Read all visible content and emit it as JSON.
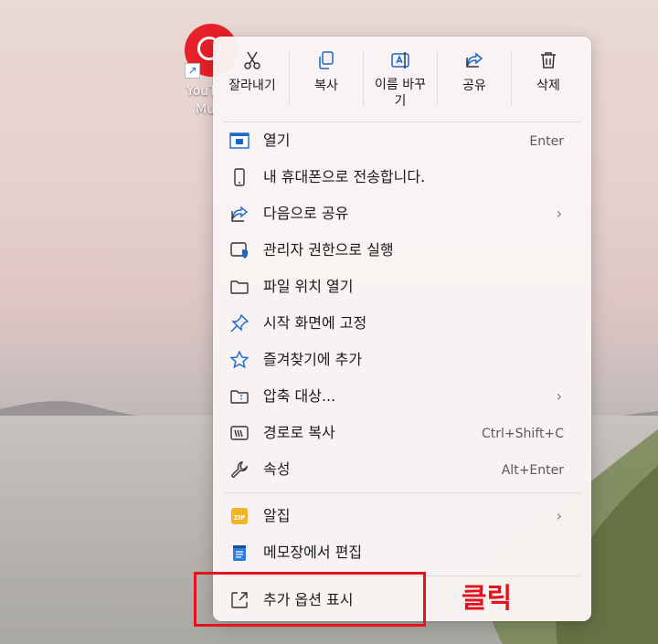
{
  "desktop": {
    "icon_label_line1": "YouTube",
    "icon_label_line2": "Music"
  },
  "toolbar": [
    {
      "label": "잘라내기",
      "icon": "scissors-icon"
    },
    {
      "label": "복사",
      "icon": "copy-icon"
    },
    {
      "label_line1": "이름 바꾸",
      "label_line2": "기",
      "icon": "rename-icon"
    },
    {
      "label": "공유",
      "icon": "share-icon"
    },
    {
      "label": "삭제",
      "icon": "trash-icon"
    }
  ],
  "items": [
    {
      "label": "열기",
      "shortcut": "Enter",
      "icon": "app-window-icon"
    },
    {
      "label": "내 휴대폰으로 전송합니다.",
      "icon": "phone-icon"
    },
    {
      "label": "다음으로 공유",
      "submenu": true,
      "icon": "share-icon"
    },
    {
      "label": "관리자 권한으로 실행",
      "icon": "shield-window-icon"
    },
    {
      "label": "파일 위치 열기",
      "icon": "folder-icon"
    },
    {
      "label": "시작 화면에 고정",
      "icon": "pin-icon"
    },
    {
      "label": "즐겨찾기에 추가",
      "icon": "star-icon"
    },
    {
      "label": "압축 대상...",
      "submenu": true,
      "icon": "zip-folder-icon"
    },
    {
      "label": "경로로 복사",
      "shortcut": "Ctrl+Shift+C",
      "icon": "copy-path-icon"
    },
    {
      "label": "속성",
      "shortcut": "Alt+Enter",
      "icon": "wrench-icon"
    },
    {
      "label": "알집",
      "submenu": true,
      "icon": "alzip-icon"
    },
    {
      "label": "메모장에서 편집",
      "icon": "notepad-icon"
    },
    {
      "label": "추가 옵션 표시",
      "icon": "more-options-icon"
    }
  ],
  "annotation": {
    "click_label": "클릭",
    "color": "#e3141f"
  },
  "colors": {
    "accent": "#1a66c9",
    "youtube_red": "#e8202a"
  }
}
